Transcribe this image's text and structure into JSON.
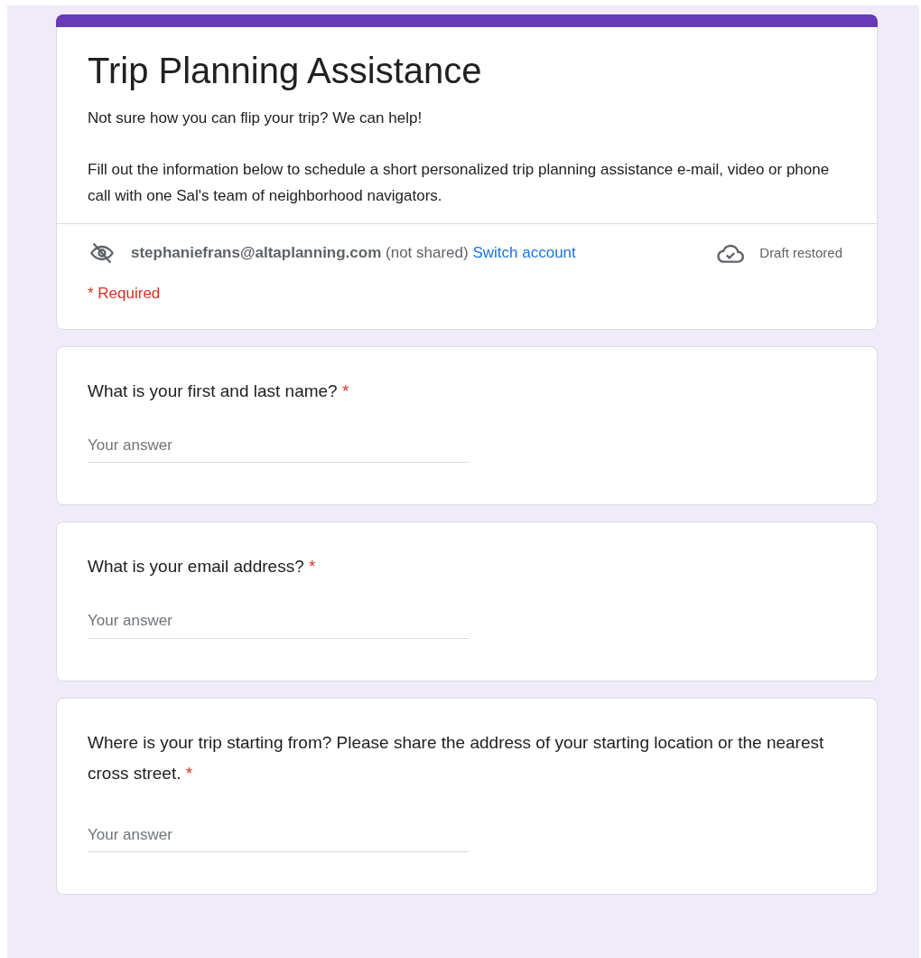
{
  "form": {
    "title": "Trip Planning Assistance",
    "description": [
      "Not sure how you can flip your trip? We can help!",
      "Fill out the information below to schedule a short personalized trip planning assistance e-mail, video or phone call with one Sal's team of neighborhood navigators."
    ],
    "account": {
      "email": "stephaniefrans@altaplanning.com",
      "sharing": "(not shared)",
      "switch_link": "Switch account",
      "draft_status": "Draft restored"
    },
    "required_note": "* Required"
  },
  "questions": [
    {
      "text": "What is your first and last name?",
      "required": true,
      "required_mark": "*",
      "placeholder": "Your answer"
    },
    {
      "text": "What is your email address?",
      "required": true,
      "required_mark": "*",
      "placeholder": "Your answer"
    },
    {
      "text": "Where is your trip starting from? Please share the address of your starting location or the nearest cross street.",
      "required": true,
      "required_mark": "*",
      "placeholder": "Your answer"
    }
  ]
}
